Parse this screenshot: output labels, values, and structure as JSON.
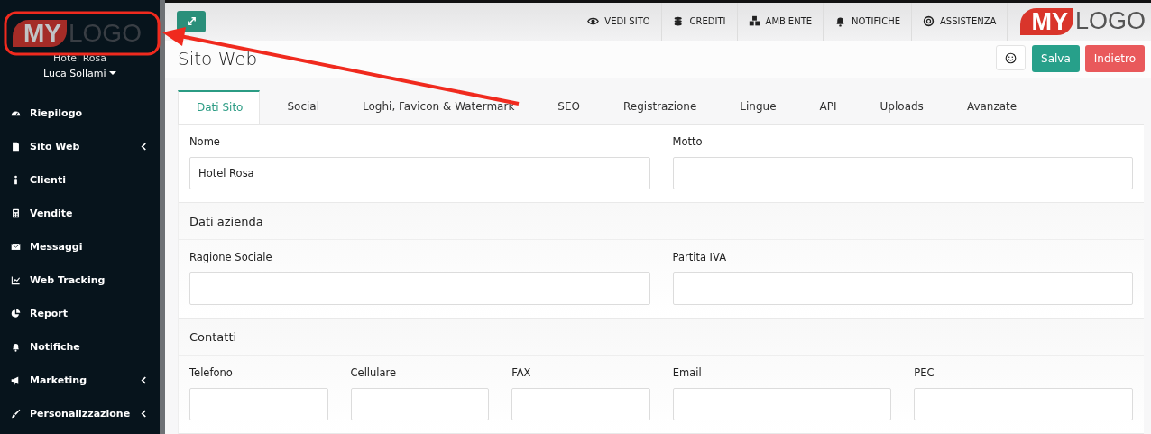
{
  "sidebar": {
    "logo": {
      "first": "MY",
      "second": "LOGO"
    },
    "hotel": "Hotel Rosa",
    "user": "Luca Sollami",
    "items": [
      {
        "label": "Riepilogo",
        "has_submenu": false
      },
      {
        "label": "Sito Web",
        "has_submenu": true
      },
      {
        "label": "Clienti",
        "has_submenu": false
      },
      {
        "label": "Vendite",
        "has_submenu": false
      },
      {
        "label": "Messaggi",
        "has_submenu": false
      },
      {
        "label": "Web Tracking",
        "has_submenu": false
      },
      {
        "label": "Report",
        "has_submenu": false
      },
      {
        "label": "Notifiche",
        "has_submenu": false
      },
      {
        "label": "Marketing",
        "has_submenu": true
      },
      {
        "label": "Personalizzazione",
        "has_submenu": true
      }
    ]
  },
  "topbar": {
    "links": [
      {
        "label": "VEDI SITO"
      },
      {
        "label": "CREDITI"
      },
      {
        "label": "AMBIENTE"
      },
      {
        "label": "NOTIFICHE"
      },
      {
        "label": "ASSISTENZA"
      }
    ],
    "logo": {
      "first": "MY",
      "second": "LOGO"
    }
  },
  "page": {
    "title": "Sito Web",
    "buttons": [
      {
        "label": "Salva",
        "kind": "primary"
      },
      {
        "label": "Indietro",
        "kind": "danger"
      }
    ]
  },
  "tabs": [
    {
      "label": "Dati Sito",
      "selected": true
    },
    {
      "label": "Social",
      "selected": false
    },
    {
      "label": "Loghi, Favicon & Watermark",
      "selected": false
    },
    {
      "label": "SEO",
      "selected": false
    },
    {
      "label": "Registrazione",
      "selected": false
    },
    {
      "label": "Lingue",
      "selected": false
    },
    {
      "label": "API",
      "selected": false
    },
    {
      "label": "Uploads",
      "selected": false
    },
    {
      "label": "Avanzate",
      "selected": false
    }
  ],
  "sections": [
    {
      "kind": "pair",
      "fields": [
        {
          "label": "Nome",
          "value": "Hotel Rosa"
        },
        {
          "label": "Motto"
        }
      ]
    },
    {
      "kind": "pair",
      "title": "Dati azienda",
      "fields": [
        {
          "label": "Ragione Sociale"
        },
        {
          "label": "Partita IVA"
        }
      ]
    },
    {
      "kind": "contacts",
      "title": "Contatti",
      "fields": [
        {
          "label": "Telefono"
        },
        {
          "label": "Cellulare"
        },
        {
          "label": "FAX"
        },
        {
          "label": "Email"
        },
        {
          "label": "PEC"
        }
      ]
    }
  ]
}
